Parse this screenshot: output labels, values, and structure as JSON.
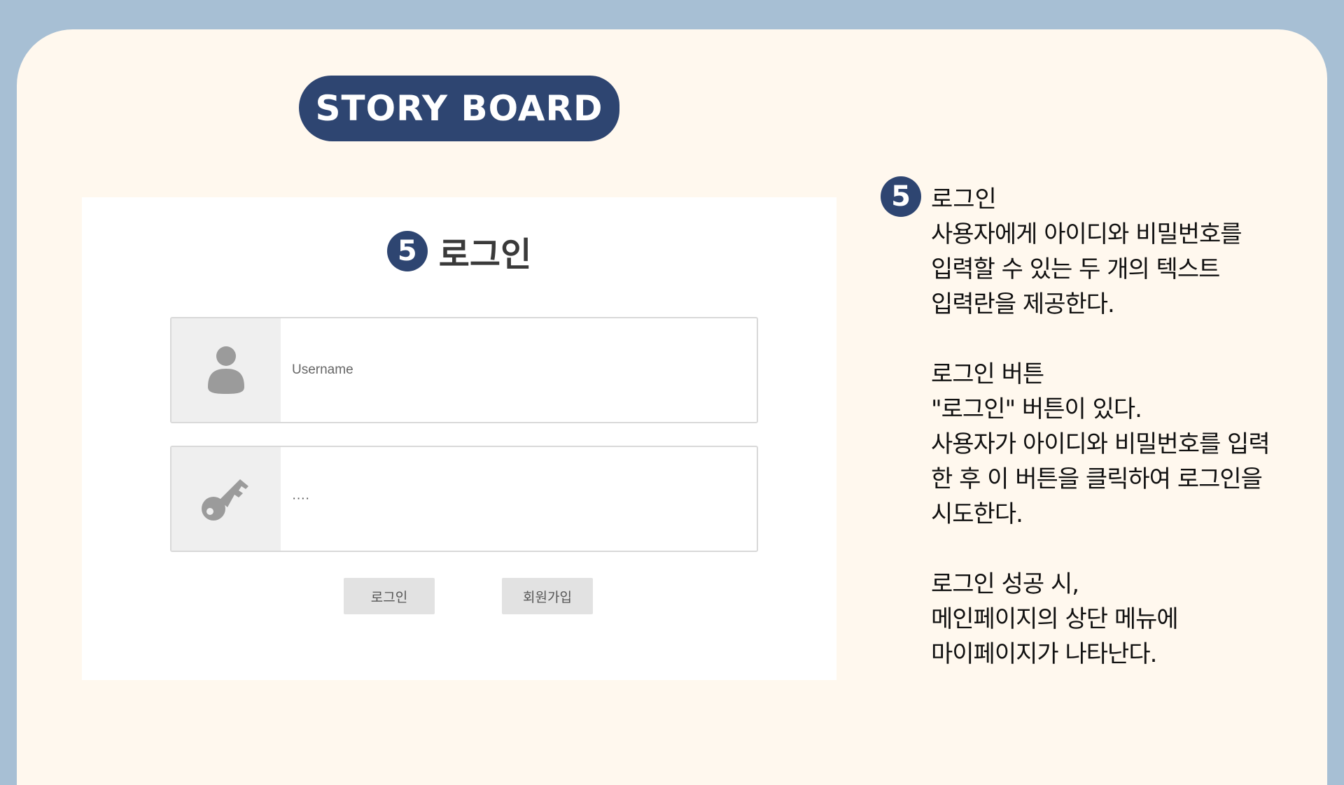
{
  "badge": {
    "label": "STORY BOARD"
  },
  "mockup": {
    "step_number": "5",
    "title": "로그인",
    "username": {
      "placeholder": "Username",
      "icon": "user-icon"
    },
    "password": {
      "value": "····",
      "icon": "key-icon"
    },
    "buttons": {
      "login": "로그인",
      "signup": "회원가입"
    }
  },
  "description": {
    "step_number": "5",
    "title": "로그인",
    "section1": [
      "사용자에게 아이디와 비밀번호를",
      "입력할 수 있는 두 개의 텍스트",
      "입력란을 제공한다."
    ],
    "section2": [
      "로그인 버튼",
      "\"로그인\" 버튼이 있다.",
      "사용자가 아이디와 비밀번호를 입력",
      "한 후 이 버튼을 클릭하여 로그인을",
      "시도한다."
    ],
    "section3": [
      "로그인 성공 시,",
      "메인페이지의 상단 메뉴에",
      "마이페이지가 나타난다."
    ]
  },
  "colors": {
    "background": "#a7bfd4",
    "paper": "#fff8ee",
    "accent": "#2e4571"
  }
}
